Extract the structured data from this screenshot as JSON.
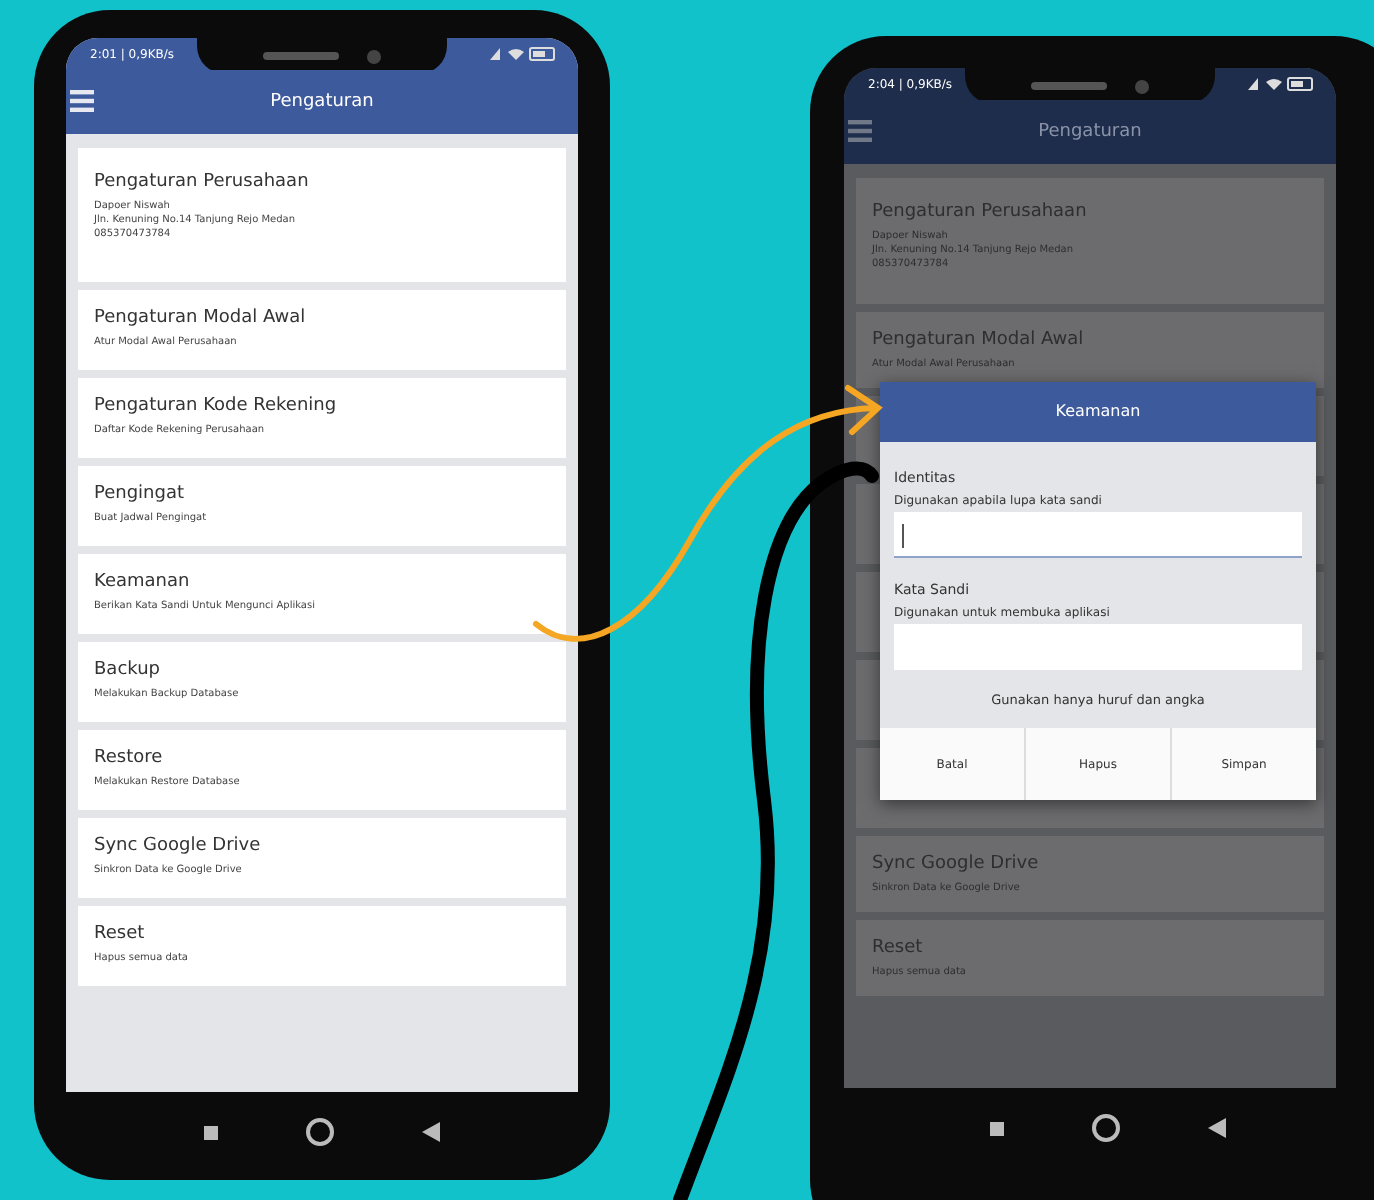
{
  "phones": [
    {
      "status_time": "2:01 | 0,9KB/s",
      "app_bar": {
        "title": "Pengaturan"
      },
      "settings": [
        {
          "title": "Pengaturan Perusahaan",
          "lines": [
            "Dapoer Niswah",
            "Jln. Kenuning No.14 Tanjung Rejo Medan",
            "085370473784"
          ]
        },
        {
          "title": "Pengaturan Modal Awal",
          "lines": [
            "Atur Modal Awal Perusahaan"
          ]
        },
        {
          "title": "Pengaturan Kode Rekening",
          "lines": [
            "Daftar Kode Rekening Perusahaan"
          ]
        },
        {
          "title": "Pengingat",
          "lines": [
            "Buat Jadwal Pengingat"
          ]
        },
        {
          "title": "Keamanan",
          "lines": [
            "Berikan Kata Sandi Untuk Mengunci Aplikasi"
          ]
        },
        {
          "title": "Backup",
          "lines": [
            "Melakukan Backup Database"
          ]
        },
        {
          "title": "Restore",
          "lines": [
            "Melakukan Restore Database"
          ]
        },
        {
          "title": "Sync Google Drive",
          "lines": [
            "Sinkron Data ke Google Drive"
          ]
        },
        {
          "title": "Reset",
          "lines": [
            "Hapus semua data"
          ]
        }
      ]
    },
    {
      "status_time": "2:04 | 0,9KB/s",
      "app_bar": {
        "title": "Pengaturan"
      },
      "settings": [
        {
          "title": "Pengaturan Perusahaan",
          "lines": [
            "Dapoer Niswah",
            "Jln. Kenuning No.14 Tanjung Rejo Medan",
            "085370473784"
          ]
        },
        {
          "title": "Pengaturan Modal Awal",
          "lines": [
            "Atur Modal Awal Perusahaan"
          ]
        },
        {
          "kind": "hidden"
        },
        {
          "kind": "hidden"
        },
        {
          "kind": "hidden"
        },
        {
          "kind": "hidden"
        },
        {
          "kind": "hidden"
        },
        {
          "title": "Sync Google Drive",
          "lines": [
            "Sinkron Data ke Google Drive"
          ]
        },
        {
          "title": "Reset",
          "lines": [
            "Hapus semua data"
          ]
        }
      ],
      "dialog": {
        "title": "Keamanan",
        "fields": [
          {
            "label": "Identitas",
            "hint": "Digunakan apabila lupa kata sandi",
            "focused": true
          },
          {
            "label": "Kata Sandi",
            "hint": "Digunakan untuk membuka aplikasi",
            "focused": false
          }
        ],
        "note": "Gunakan hanya huruf dan angka",
        "buttons": [
          "Batal",
          "Hapus",
          "Simpan"
        ]
      }
    }
  ]
}
